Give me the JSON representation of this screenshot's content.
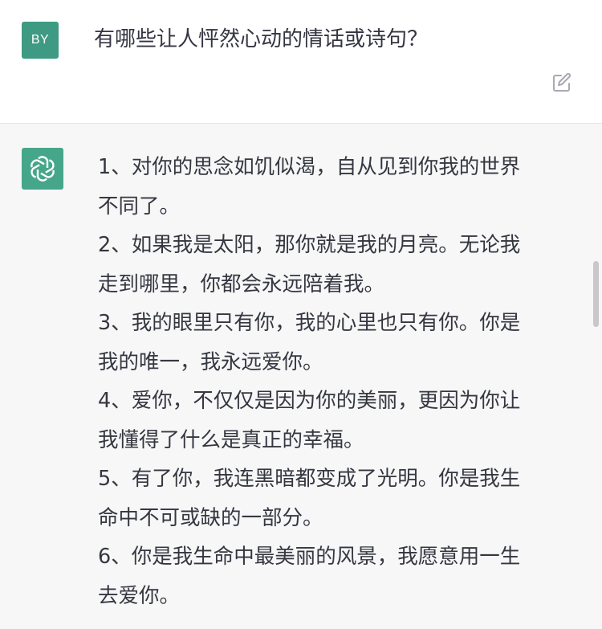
{
  "user_message": {
    "avatar_initials": "BY",
    "text": "有哪些让人怦然心动的情话或诗句？"
  },
  "assistant_message": {
    "items": [
      {
        "line1": "1、对你的思念如饥似渴，自从见到你我的世界",
        "line2": "不同了。"
      },
      {
        "line1": "2、如果我是太阳，那你就是我的月亮。无论我",
        "line2": "走到哪里，你都会永远陪着我。"
      },
      {
        "line1": "3、我的眼里只有你，我的心里也只有你。你是",
        "line2": "我的唯一，我永远爱你。"
      },
      {
        "line1": "4、爱你，不仅仅是因为你的美丽，更因为你让",
        "line2": "我懂得了什么是真正的幸福。"
      },
      {
        "line1": "5、有了你，我连黑暗都变成了光明。你是我生",
        "line2": "命中不可或缺的一部分。"
      },
      {
        "line1": "6、你是我生命中最美丽的风景，我愿意用一生",
        "line2": "去爱你。"
      }
    ]
  },
  "icons": {
    "edit": "edit-icon",
    "assistant_logo": "openai-logo-icon"
  },
  "colors": {
    "user_avatar": "#3e9a82",
    "assistant_avatar": "#46a689",
    "assistant_background": "#f7f7f8",
    "text": "#353740"
  }
}
